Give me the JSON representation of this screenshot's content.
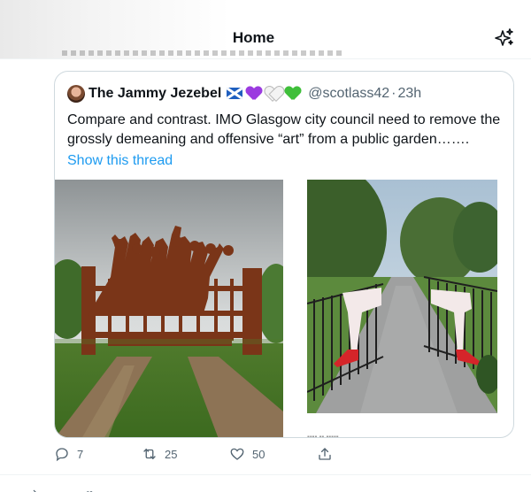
{
  "header": {
    "title": "Home",
    "sparkle_icon": "sparkle-icon"
  },
  "quote_tweet": {
    "author_name": "The Jammy Jezebel",
    "badges": [
      "scotland-flag-icon",
      "purple-heart-icon",
      "white-heart-icon",
      "green-heart-icon"
    ],
    "handle": "@scotlass42",
    "separator": "·",
    "time": "23h",
    "text": "Compare and contrast. IMO Glasgow city council need to remove the grossly demeaning and offensive “art” from a public garden…….",
    "show_thread": "Show this thread",
    "images": [
      {
        "name": "gate-sculpture-photo",
        "desc": "rusted steel gate sculpture of dancing women"
      },
      {
        "name": "gate-legs-photo",
        "desc": "park gate with painted legs and red heels"
      }
    ]
  },
  "actions": {
    "reply_count": "7",
    "retweet_count": "25",
    "like_count": "50",
    "reply_icon": "reply-icon",
    "retweet_icon": "retweet-icon",
    "like_icon": "heart-icon",
    "share_icon": "share-icon"
  },
  "colors": {
    "link": "#1d9bf0",
    "muted": "#536471",
    "border": "#cfd9de"
  }
}
